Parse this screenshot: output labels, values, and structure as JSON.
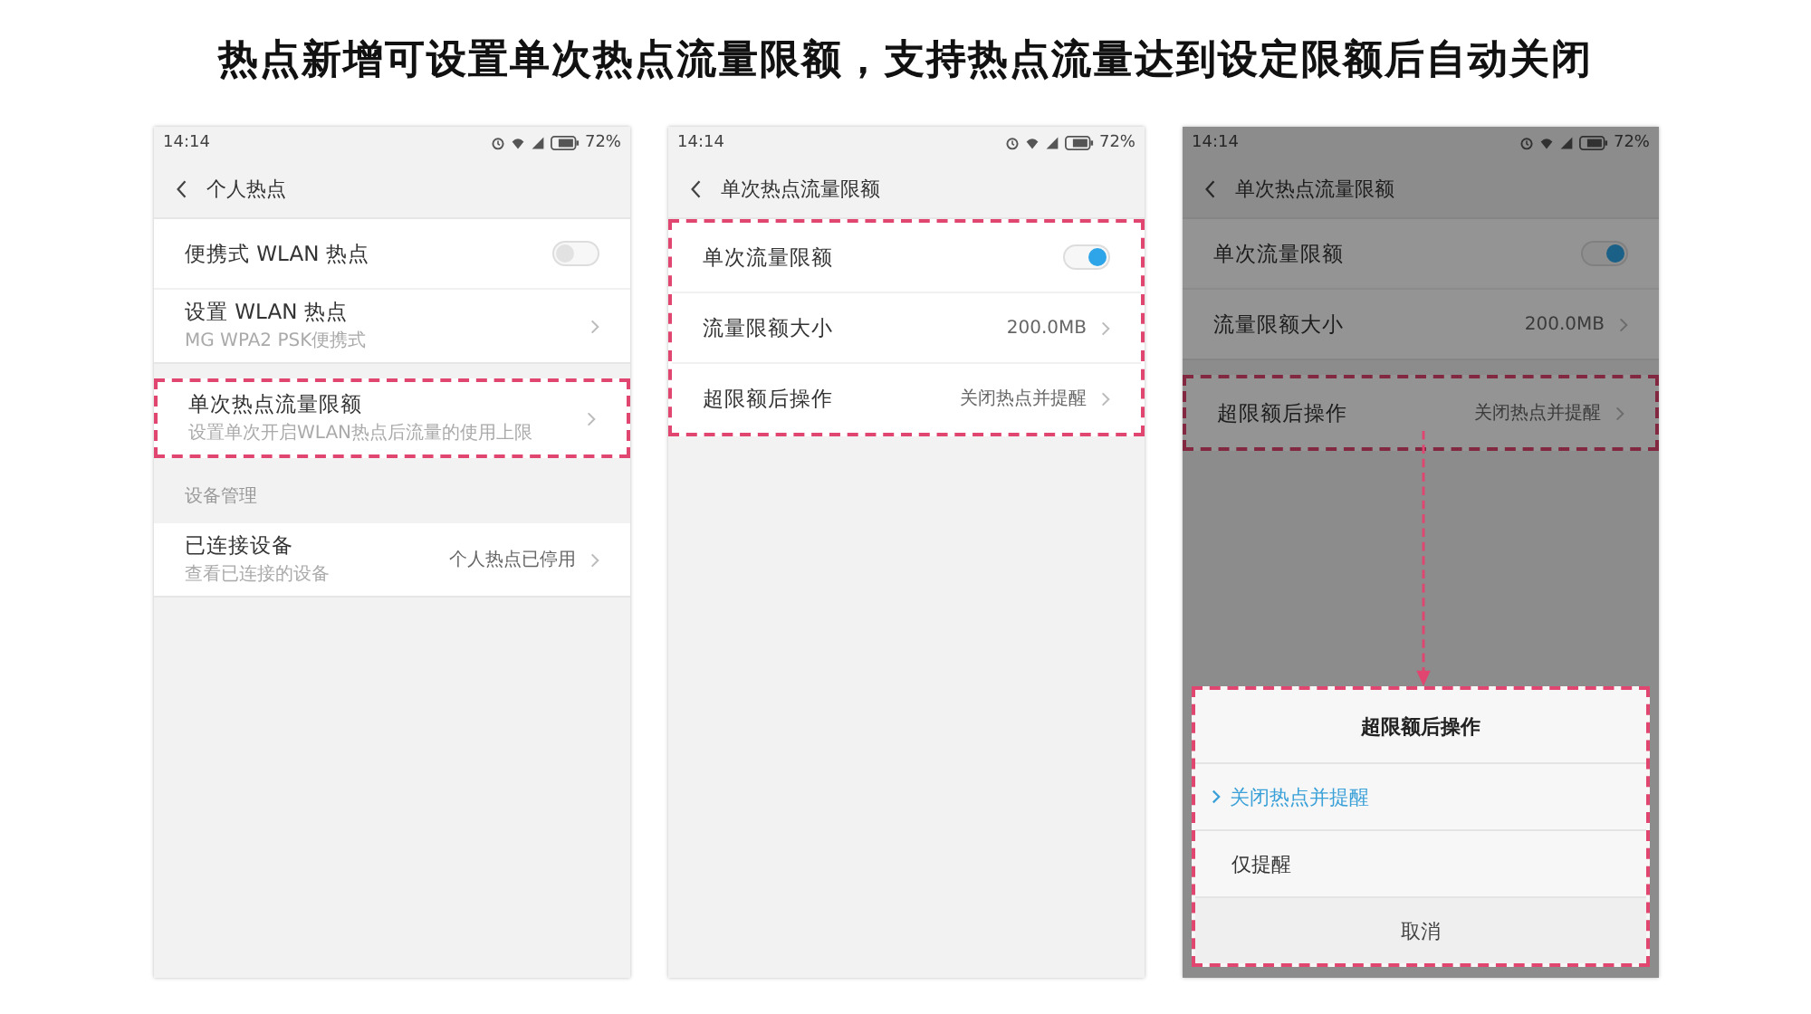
{
  "headline": "热点新增可设置单次热点流量限额，支持热点流量达到设定限额后自动关闭",
  "phones": [
    {
      "time": "14:14",
      "battery": "72%",
      "title": "个人热点",
      "dimmed": false,
      "sections": [
        {
          "kind": "group",
          "highlighted": false,
          "rows": [
            {
              "kind": "toggle",
              "title": "便携式 WLAN 热点",
              "on": false
            },
            {
              "kind": "nav",
              "title": "设置 WLAN 热点",
              "subtitle": "MG WPA2 PSK便携式"
            }
          ]
        },
        {
          "kind": "group",
          "highlighted": true,
          "rows": [
            {
              "kind": "nav",
              "title": "单次热点流量限额",
              "subtitle": "设置单次开启WLAN热点后流量的使用上限"
            }
          ]
        },
        {
          "kind": "label",
          "text": "设备管理"
        },
        {
          "kind": "group",
          "highlighted": false,
          "rows": [
            {
              "kind": "nav",
              "title": "已连接设备",
              "subtitle": "查看已连接的设备",
              "value": "个人热点已停用"
            }
          ]
        }
      ]
    },
    {
      "time": "14:14",
      "battery": "72%",
      "title": "单次热点流量限额",
      "dimmed": false,
      "sections": [
        {
          "kind": "group",
          "highlighted": true,
          "rows": [
            {
              "kind": "toggle",
              "title": "单次流量限额",
              "on": true
            },
            {
              "kind": "nav",
              "title": "流量限额大小",
              "value": "200.0MB"
            },
            {
              "kind": "nav",
              "title": "超限额后操作",
              "value": "关闭热点并提醒"
            }
          ]
        }
      ]
    },
    {
      "time": "14:14",
      "battery": "72%",
      "title": "单次热点流量限额",
      "dimmed": true,
      "sections": [
        {
          "kind": "group",
          "highlighted": false,
          "rows": [
            {
              "kind": "toggle",
              "title": "单次流量限额",
              "on": true
            },
            {
              "kind": "nav",
              "title": "流量限额大小",
              "value": "200.0MB"
            }
          ]
        },
        {
          "kind": "group",
          "highlighted": true,
          "rows": [
            {
              "kind": "nav",
              "title": "超限额后操作",
              "value": "关闭热点并提醒"
            }
          ]
        }
      ],
      "dialog": {
        "title": "超限额后操作",
        "highlighted": true,
        "options": [
          {
            "label": "关闭热点并提醒",
            "selected": true
          },
          {
            "label": "仅提醒",
            "selected": false
          }
        ],
        "cancel": "取消"
      }
    }
  ]
}
